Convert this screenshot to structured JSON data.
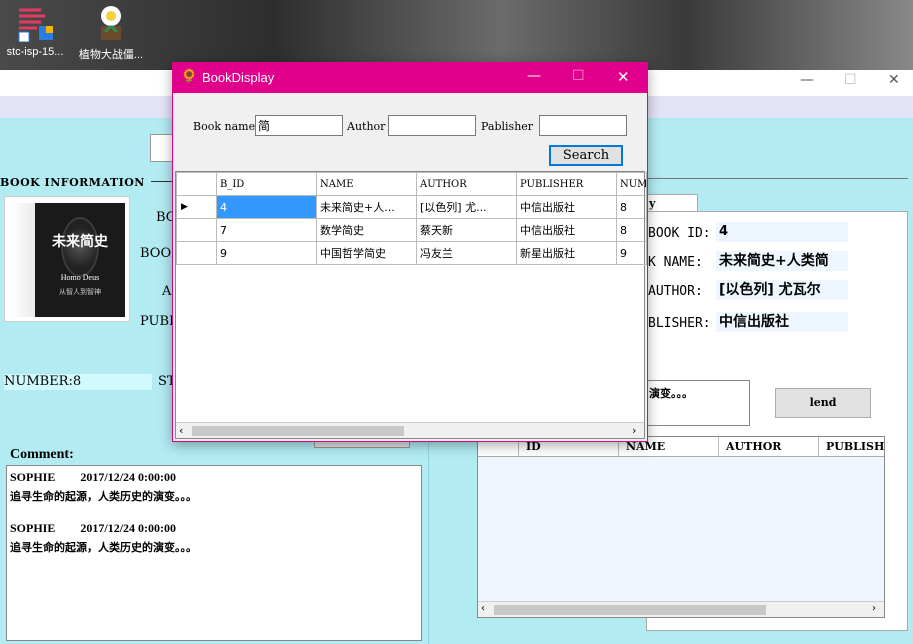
{
  "desktop": {
    "icons": [
      {
        "label": "stc-isp-15...",
        "glyph": "⧉"
      },
      {
        "label": "植物大战僵...",
        "glyph": "✿"
      }
    ]
  },
  "main_window": {
    "section_title": "BOOK INFORMATION",
    "book_cover": {
      "title": "未来简史",
      "subtitle": "Homo Deus",
      "caption": "从智人到智神"
    },
    "partial_labels": {
      "bo": "BO",
      "book": "BOOK",
      "a": "A",
      "publ": "PUBL",
      "st": "ST"
    },
    "number_label": "NUMBER:8",
    "comment_label": "Comment:",
    "comments": [
      {
        "user": "SOPHIE",
        "time": "2017/12/24 0:00:00",
        "text": "追寻生命的起源，人类历史的演变。。。"
      },
      {
        "user": "SOPHIE",
        "time": "2017/12/24 0:00:00",
        "text": "追寻生命的起源，人类历史的演变。。。"
      }
    ],
    "tab_partial": "y borrow",
    "detail": {
      "book_id_label": "BOOK ID:",
      "book_id": "4",
      "name_label": "K NAME:",
      "name": "未来简史+人类简",
      "author_label": "AUTHOR:",
      "author": "[以色列] 尤瓦尔",
      "publisher_label": "BLISHER:",
      "publisher": "中信出版社",
      "desc_partial": "演变。。。"
    },
    "lend_button": "lend",
    "lower_grid_headers": [
      "ID",
      "NAME",
      "AUTHOR",
      "PUBLISHI"
    ]
  },
  "dialog": {
    "title": "BookDisplay",
    "minimize": "—",
    "maximize": "☐",
    "close": "✕",
    "book_name_label": "Book name",
    "book_name_value": "简",
    "author_label": "Author",
    "author_value": "",
    "publisher_label": "Pablisher",
    "publisher_value": "",
    "search_button": "Search",
    "columns": [
      "B_ID",
      "NAME",
      "AUTHOR",
      "PUBLISHER",
      "NUMBE"
    ],
    "rows": [
      {
        "id": "4",
        "name": "未来简史+人...",
        "author": "[以色列] 尤...",
        "publisher": "中信出版社",
        "number": "8"
      },
      {
        "id": "7",
        "name": "数学简史",
        "author": "蔡天新",
        "publisher": "中信出版社",
        "number": "8"
      },
      {
        "id": "9",
        "name": "中国哲学简史",
        "author": "冯友兰",
        "publisher": "新星出版社",
        "number": "9"
      }
    ]
  },
  "colors": {
    "accent": "#e0008c",
    "background": "#b2ebf2",
    "selection": "#3399ff"
  }
}
